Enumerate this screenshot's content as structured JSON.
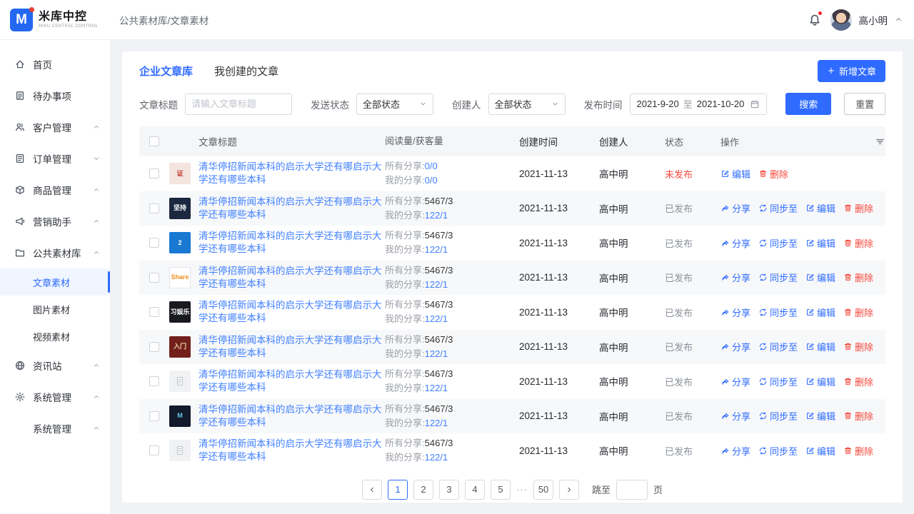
{
  "colors": {
    "primary": "#2f6bff",
    "link": "#4080ff",
    "danger": "#f5483b",
    "muted": "#8a9099"
  },
  "header": {
    "logo_letter": "M",
    "logo_text": "米库中控",
    "logo_sub": "MIKU CENTRAL CONTROL",
    "breadcrumb": "公共素材库/文章素材",
    "user_name": "高小明"
  },
  "sidebar": {
    "items": [
      {
        "label": "首页",
        "icon": "home"
      },
      {
        "label": "待办事项",
        "icon": "todo"
      },
      {
        "label": "客户管理",
        "icon": "customer",
        "chevron": "up"
      },
      {
        "label": "订单管理",
        "icon": "order",
        "chevron": "down"
      },
      {
        "label": "商品管理",
        "icon": "goods",
        "chevron": "up"
      },
      {
        "label": "营销助手",
        "icon": "marketing",
        "chevron": "up"
      },
      {
        "label": "公共素材库",
        "icon": "library",
        "chevron": "up",
        "children": [
          {
            "label": "文章素材",
            "active": true
          },
          {
            "label": "图片素材"
          },
          {
            "label": "视频素材"
          }
        ]
      },
      {
        "label": "资讯站",
        "icon": "news",
        "chevron": "up"
      },
      {
        "label": "系统管理",
        "icon": "settings",
        "chevron": "up"
      },
      {
        "label": "系统管理",
        "icon": "",
        "chevron": "up"
      }
    ]
  },
  "tabs": {
    "active": "企业文章库",
    "secondary": "我创建的文章"
  },
  "new_button": "新增文章",
  "filters": {
    "title_label": "文章标题",
    "title_placeholder": "请输入文章标题",
    "send_status_label": "发送状态",
    "send_status_value": "全部状态",
    "creator_label": "创建人",
    "creator_value": "全部状态",
    "publish_time_label": "发布时间",
    "date_from": "2021-9-20",
    "date_sep": "至",
    "date_to": "2021-10-20",
    "search_label": "搜索",
    "reset_label": "重置"
  },
  "table": {
    "headers": [
      "文章标题",
      "阅读量/获客量",
      "创建时间",
      "创建人",
      "状态",
      "操作"
    ],
    "reads_all_label": "所有分享:",
    "reads_mine_label": "我的分享:",
    "ops_labels": {
      "share": "分享",
      "sync": "同步至",
      "edit": "编辑",
      "delete": "删除"
    },
    "rows": [
      {
        "title": "清华停招新闻本科的启示大学还有哪启示大学还有哪些本科",
        "reads_all": "0/0",
        "reads_all_blue": true,
        "reads_mine": "0/0",
        "created": "2021-11-13",
        "creator": "高中明",
        "status": {
          "label": "未发布",
          "type": "unpublished"
        },
        "ops": [
          "edit",
          "delete"
        ],
        "thumb": {
          "bg": "#f3e4de",
          "text": "证",
          "color": "#c5392f"
        }
      },
      {
        "title": "清华停招新闻本科的启示大学还有哪启示大学还有哪些本科",
        "reads_all": "5467/3",
        "reads_mine": "122/1",
        "created": "2021-11-13",
        "creator": "高中明",
        "status": {
          "label": "已发布",
          "type": "published"
        },
        "ops": [
          "share",
          "sync",
          "edit",
          "delete"
        ],
        "thumb": {
          "bg": "#1c2740",
          "text": "坚持",
          "color": "#ffffff"
        }
      },
      {
        "title": "清华停招新闻本科的启示大学还有哪启示大学还有哪些本科",
        "reads_all": "5467/3",
        "reads_mine": "122/1",
        "created": "2021-11-13",
        "creator": "高中明",
        "status": {
          "label": "已发布",
          "type": "published"
        },
        "ops": [
          "share",
          "sync",
          "edit",
          "delete"
        ],
        "thumb": {
          "bg": "#1878d2",
          "text": "2",
          "color": "#ffffff"
        }
      },
      {
        "title": "清华停招新闻本科的启示大学还有哪启示大学还有哪些本科",
        "reads_all": "5467/3",
        "reads_mine": "122/1",
        "created": "2021-11-13",
        "creator": "高中明",
        "status": {
          "label": "已发布",
          "type": "published"
        },
        "ops": [
          "share",
          "sync",
          "edit",
          "delete"
        ],
        "thumb": {
          "bg": "#ffffff",
          "text": "Share",
          "color": "#f08c1e",
          "border": true
        }
      },
      {
        "title": "清华停招新闻本科的启示大学还有哪启示大学还有哪些本科",
        "reads_all": "5467/3",
        "reads_mine": "122/1",
        "created": "2021-11-13",
        "creator": "高中明",
        "status": {
          "label": "已发布",
          "type": "published"
        },
        "ops": [
          "share",
          "sync",
          "edit",
          "delete"
        ],
        "thumb": {
          "bg": "#191a20",
          "text": "习娱乐",
          "color": "#ffffff"
        }
      },
      {
        "title": "清华停招新闻本科的启示大学还有哪启示大学还有哪些本科",
        "reads_all": "5467/3",
        "reads_mine": "122/1",
        "created": "2021-11-13",
        "creator": "高中明",
        "status": {
          "label": "已发布",
          "type": "published"
        },
        "ops": [
          "share",
          "sync",
          "edit",
          "delete"
        ],
        "thumb": {
          "bg": "#73201c",
          "text": "入门",
          "color": "#f0d7a8"
        }
      },
      {
        "title": "清华停招新闻本科的启示大学还有哪启示大学还有哪些本科",
        "reads_all": "5467/3",
        "reads_mine": "122/1",
        "created": "2021-11-13",
        "creator": "高中明",
        "status": {
          "label": "已发布",
          "type": "published"
        },
        "ops": [
          "share",
          "sync",
          "edit",
          "delete"
        ],
        "thumb": {
          "type": "placeholder"
        }
      },
      {
        "title": "清华停招新闻本科的启示大学还有哪启示大学还有哪些本科",
        "reads_all": "5467/3",
        "reads_mine": "122/1",
        "created": "2021-11-13",
        "creator": "高中明",
        "status": {
          "label": "已发布",
          "type": "published"
        },
        "ops": [
          "share",
          "sync",
          "edit",
          "delete"
        ],
        "thumb": {
          "bg": "#121a2b",
          "text": "M",
          "color": "#63c8de"
        }
      },
      {
        "title": "清华停招新闻本科的启示大学还有哪启示大学还有哪些本科",
        "reads_all": "5467/3",
        "reads_mine": "122/1",
        "created": "2021-11-13",
        "creator": "高中明",
        "status": {
          "label": "已发布",
          "type": "published"
        },
        "ops": [
          "share",
          "sync",
          "edit",
          "delete"
        ],
        "thumb": {
          "type": "placeholder"
        }
      }
    ]
  },
  "pagination": {
    "pages": [
      "1",
      "2",
      "3",
      "4",
      "5",
      "...",
      "50"
    ],
    "active": "1",
    "jump_label": "跳至",
    "page_label": "页",
    "jump_value": ""
  }
}
